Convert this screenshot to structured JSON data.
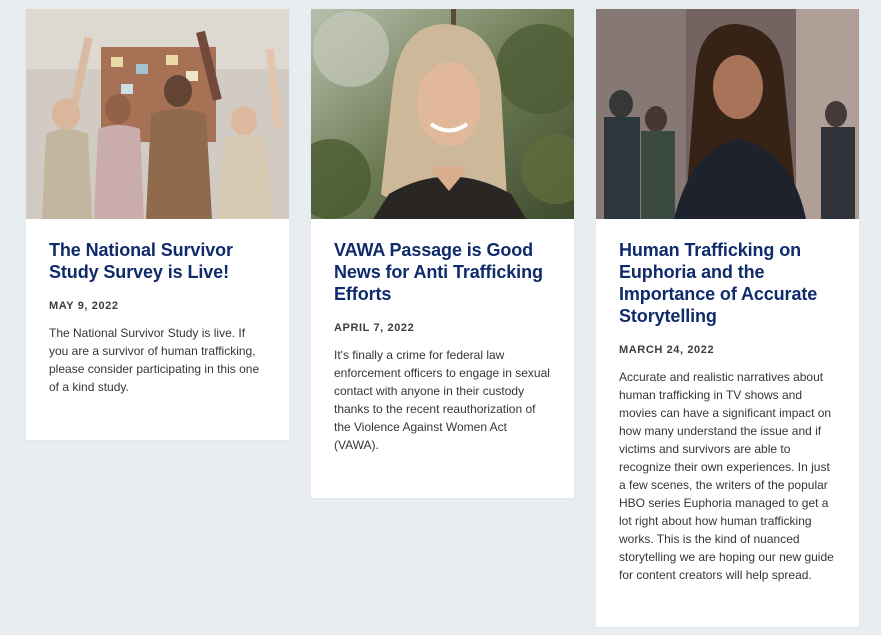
{
  "posts": [
    {
      "title": "The National Survivor Study Survey is Live!",
      "date": "MAY 9, 2022",
      "excerpt": "The National Survivor Study is live. If you are a survivor of human trafficking, please consider participating in this one of a kind study."
    },
    {
      "title": "VAWA Passage is Good News for Anti Trafficking Efforts",
      "date": "APRIL 7, 2022",
      "excerpt": "It's finally a crime for federal law enforcement officers to engage in sexual contact with anyone in their custody thanks to the recent reauthorization of the Violence Against Women Act (VAWA)."
    },
    {
      "title": "Human Trafficking on Euphoria and the Importance of Accurate Storytelling",
      "date": "MARCH 24, 2022",
      "excerpt": "Accurate and realistic narratives about human trafficking in TV shows and movies can have a significant impact on how many understand the issue and if victims and survivors are able to recognize their own experiences. In just a few scenes, the writers of the popular HBO series Euphoria managed to get a lot right about how human trafficking works. This is the kind of nuanced storytelling we are hoping our new guide for content creators will help spread."
    }
  ],
  "colors": {
    "background": "#e8edf1",
    "card": "#ffffff",
    "title": "#0f2b6b",
    "text": "#33363b"
  }
}
